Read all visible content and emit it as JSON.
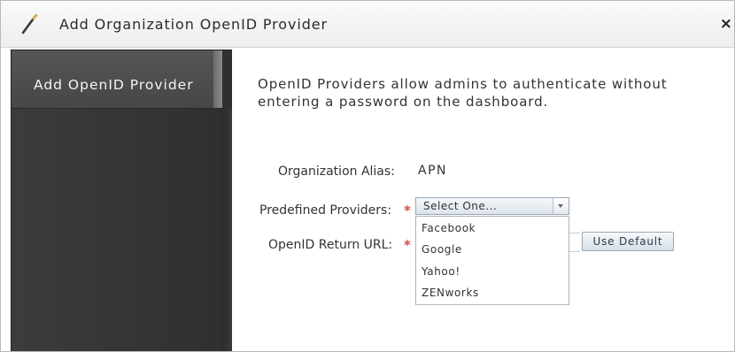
{
  "dialog": {
    "title": "Add Organization OpenID Provider",
    "close_label": "×"
  },
  "sidebar": {
    "items": [
      {
        "label": "Add OpenID Provider"
      }
    ]
  },
  "content": {
    "description": "OpenID Providers allow admins to authenticate without entering a password on the dashboard.",
    "required_marker": "*",
    "alias": {
      "label": "Organization Alias:",
      "value": "APN"
    },
    "predefined": {
      "label": "Predefined Providers:",
      "selected": "Select One...",
      "options": [
        "Facebook",
        "Google",
        "Yahoo!",
        "ZENworks"
      ]
    },
    "return_url": {
      "label": "OpenID Return URL:",
      "use_default_label": "Use Default"
    }
  },
  "colors": {
    "sidebar_bg": "#333333",
    "required": "#d64a4a",
    "button_border": "#9aa7b5"
  },
  "icons": {
    "title_icon": "wand-icon",
    "close_icon": "close-icon"
  }
}
